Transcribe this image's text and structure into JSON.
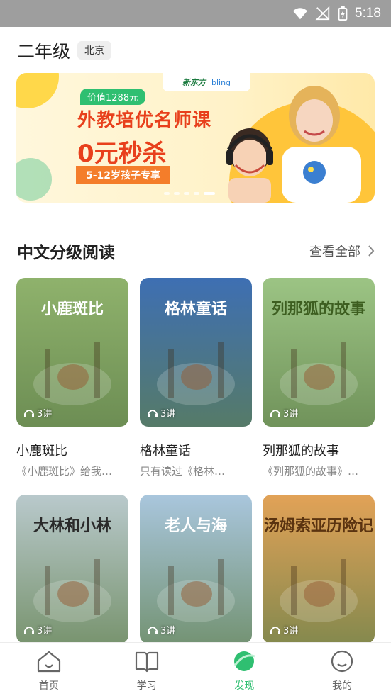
{
  "status_bar": {
    "time": "5:18"
  },
  "header": {
    "grade": "二年级",
    "city": "北京"
  },
  "banner": {
    "brand_left": "新东方",
    "brand_right": "bling",
    "price_tag": "价值1288元",
    "title_line1": "外教培优名师课",
    "title_line2": "0元秒杀",
    "ribbon": "5-12岁孩子专享",
    "page_count": 5,
    "active_page": 5
  },
  "section": {
    "title": "中文分级阅读",
    "see_all": "查看全部"
  },
  "books": [
    {
      "cover_title": "小鹿斑比",
      "lessons": "3讲",
      "name": "小鹿斑比",
      "desc": "《小鹿斑比》给我…",
      "bg": "#8fb26c",
      "title_color": "#ffffff"
    },
    {
      "cover_title": "格林童话",
      "lessons": "3讲",
      "name": "格林童话",
      "desc": "只有读过《格林…",
      "bg": "#3e6fb3",
      "title_color": "#ffffff"
    },
    {
      "cover_title": "列那狐的故事",
      "lessons": "3讲",
      "name": "列那狐的故事",
      "desc": "《列那狐的故事》…",
      "bg": "#9cc484",
      "title_color": "#3d5e20"
    },
    {
      "cover_title": "大林和小林",
      "lessons": "3讲",
      "name": "",
      "desc": "",
      "bg": "#b9c9cc",
      "title_color": "#2a2a2a"
    },
    {
      "cover_title": "老人与海",
      "lessons": "3讲",
      "name": "",
      "desc": "",
      "bg": "#a9c6dd",
      "title_color": "#ffffff"
    },
    {
      "cover_title": "汤姆索亚历险记",
      "lessons": "3讲",
      "name": "",
      "desc": "",
      "bg": "#e2a257",
      "title_color": "#5a3310"
    }
  ],
  "tabs": [
    {
      "label": "首页",
      "icon": "home-icon",
      "active": false
    },
    {
      "label": "学习",
      "icon": "book-icon",
      "active": false
    },
    {
      "label": "发现",
      "icon": "planet-icon",
      "active": true
    },
    {
      "label": "我的",
      "icon": "profile-icon",
      "active": false
    }
  ],
  "colors": {
    "accent": "#2fbf71",
    "banner_red": "#e8401c",
    "ribbon": "#f47d2a"
  }
}
